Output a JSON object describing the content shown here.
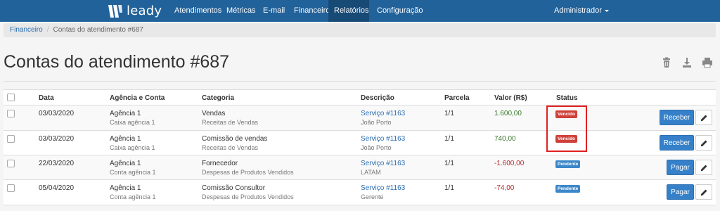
{
  "brand": {
    "name": "leady"
  },
  "nav": {
    "items": [
      {
        "label": "Atendimentos"
      },
      {
        "label": "Métricas"
      },
      {
        "label": "E-mail"
      },
      {
        "label": "Financeiro"
      },
      {
        "label": "Relatórios",
        "active": true
      },
      {
        "label": "Configuração"
      }
    ],
    "user": "Administrador"
  },
  "breadcrumb": {
    "parent": "Financeiro",
    "separator": "/",
    "current": "Contas do atendimento #687"
  },
  "page": {
    "title": "Contas do atendimento #687"
  },
  "toolbar": {
    "icons": [
      "trash-icon",
      "download-icon",
      "print-icon"
    ]
  },
  "table": {
    "columns": {
      "date": "Data",
      "agency": "Agência e Conta",
      "category": "Categoria",
      "description": "Descrição",
      "installment": "Parcela",
      "value": "Valor (R$)",
      "status": "Status"
    },
    "rows": [
      {
        "date": "03/03/2020",
        "agency": "Agência 1",
        "account": "Caixa agência 1",
        "category": "Vendas",
        "subcategory": "Receitas de Vendas",
        "description": "Serviço #1163",
        "person": "João Porto",
        "installment": "1/1",
        "value": "1.600,00",
        "status": "Vencido",
        "action": "Receber"
      },
      {
        "date": "03/03/2020",
        "agency": "Agência 1",
        "account": "Caixa agência 1",
        "category": "Comissão de vendas",
        "subcategory": "Receitas de Vendas",
        "description": "Serviço #1163",
        "person": "João Porto",
        "installment": "1/1",
        "value": "740,00",
        "status": "Vencido",
        "action": "Receber"
      },
      {
        "date": "22/03/2020",
        "agency": "Agência 1",
        "account": "Conta agência 1",
        "category": "Fornecedor",
        "subcategory": "Despesas de Produtos Vendidos",
        "description": "Serviço #1163",
        "person": "LATAM",
        "installment": "1/1",
        "value": "-1.600,00",
        "status": "Pendente",
        "action": "Pagar"
      },
      {
        "date": "05/04/2020",
        "agency": "Agência 1",
        "account": "Conta agência 1",
        "category": "Comissão Consultor",
        "subcategory": "Despesas de Produtos Vendidos",
        "description": "Serviço #1163",
        "person": "Gerente",
        "installment": "1/1",
        "value": "-74,00",
        "status": "Pendente",
        "action": "Pagar"
      }
    ]
  },
  "colors": {
    "navbar": "#22629a",
    "nav_active": "#184a76",
    "primary_button": "#3580c9",
    "badge_overdue": "#d0403a",
    "badge_pending": "#3c87c9",
    "value_positive": "#3a7a2a",
    "value_negative": "#b32a2a",
    "highlight_box": "#e02020"
  }
}
